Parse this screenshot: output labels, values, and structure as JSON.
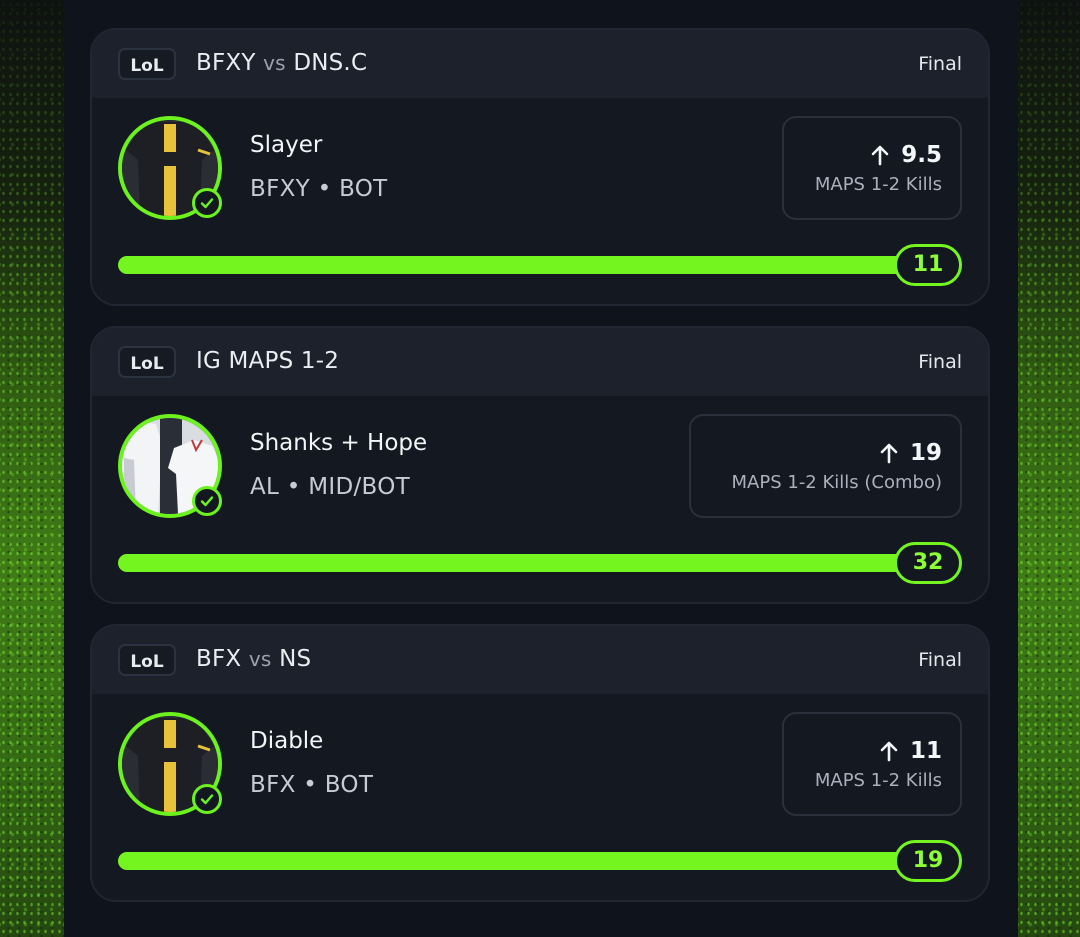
{
  "colors": {
    "accent": "#74f51f",
    "panel": "#0f131b",
    "card": "#131821"
  },
  "cards": [
    {
      "game": "LoL",
      "title_left": "BFXY",
      "title_vs": "vs",
      "title_right": "DNS.C",
      "status": "Final",
      "player": "Slayer",
      "meta": "BFXY • BOT",
      "direction_icon": "arrow-up-icon",
      "line": "9.5",
      "stat": "MAPS 1-2 Kills",
      "result": "11",
      "progress": 1.0,
      "jersey": "black-yellow"
    },
    {
      "game": "LoL",
      "title_left": "IG MAPS 1-2",
      "title_vs": "",
      "title_right": "",
      "status": "Final",
      "player": "Shanks + Hope",
      "meta": "AL • MID/BOT",
      "direction_icon": "arrow-up-icon",
      "line": "19",
      "stat": "MAPS 1-2 Kills (Combo)",
      "result": "32",
      "progress": 1.0,
      "jersey": "white-combo"
    },
    {
      "game": "LoL",
      "title_left": "BFX",
      "title_vs": "vs",
      "title_right": "NS",
      "status": "Final",
      "player": "Diable",
      "meta": "BFX • BOT",
      "direction_icon": "arrow-up-icon",
      "line": "11",
      "stat": "MAPS 1-2 Kills",
      "result": "19",
      "progress": 1.0,
      "jersey": "black-yellow"
    }
  ]
}
